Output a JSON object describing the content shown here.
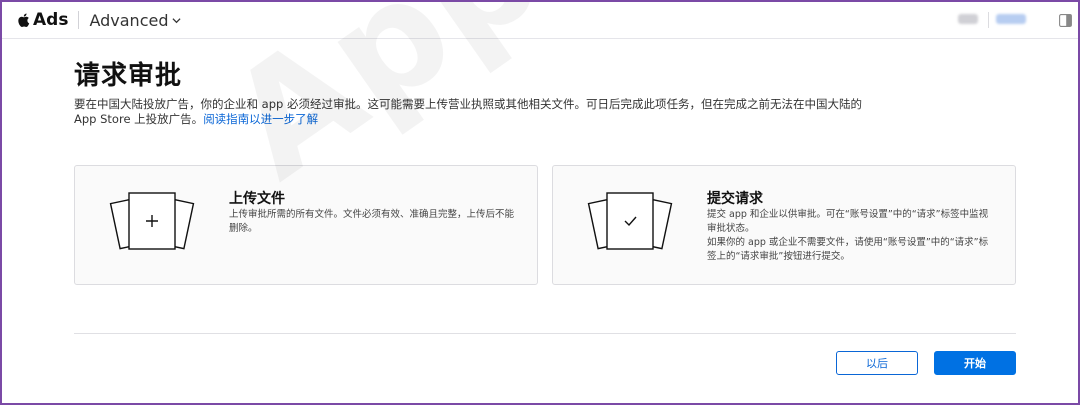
{
  "header": {
    "brand": "Ads",
    "product": "Advanced"
  },
  "page": {
    "title": "请求审批",
    "intro": "要在中国大陆投放广告，你的企业和 app 必须经过审批。这可能需要上传营业执照或其他相关文件。可日后完成此项任务，但在完成之前无法在中国大陆的 App Store 上投放广告。",
    "intro_link": "阅读指南以进一步了解"
  },
  "cards": {
    "upload": {
      "title": "上传文件",
      "description": "上传审批所需的所有文件。文件必须有效、准确且完整，上传后不能删除。",
      "icon": "plus-icon"
    },
    "submit": {
      "title": "提交请求",
      "description_1": "提交 app 和企业以供审批。可在“账号设置”中的“请求”标签中监视审批状态。",
      "description_2": "如果你的 app 或企业不需要文件，请使用“账号设置”中的“请求”标签上的“请求审批”按钮进行提交。",
      "icon": "checkmark-icon"
    }
  },
  "footer": {
    "later_label": "以后",
    "start_label": "开始"
  },
  "watermark": "AppSA",
  "colors": {
    "accent": "#0071e3",
    "link": "#0a66d6",
    "frame": "#7b4aa6"
  }
}
